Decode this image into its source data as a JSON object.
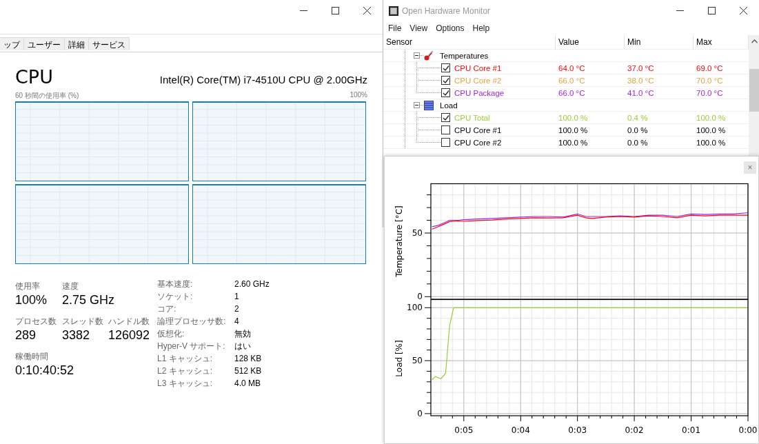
{
  "task_manager": {
    "tabs": [
      {
        "label": "ップ",
        "selected": false
      },
      {
        "label": "ユーザー",
        "selected": false
      },
      {
        "label": "詳細",
        "selected": false
      },
      {
        "label": "サービス",
        "selected": false
      }
    ],
    "heading": "CPU",
    "cpu_name": "Intel(R) Core(TM) i7-4510U CPU @ 2.00GHz",
    "graph_caption": "60 秒間の使用率 (%)",
    "graph_max": "100%",
    "cpu_graphs": [
      {
        "kind": "graph"
      },
      {
        "kind": "graph"
      },
      {
        "kind": "graph"
      },
      {
        "kind": "graph"
      }
    ],
    "stat_rows": [
      [
        {
          "label": "使用率",
          "value": "100%"
        },
        {
          "label": "速度",
          "value": "2.75 GHz"
        }
      ],
      [
        {
          "label": "プロセス数",
          "value": "289"
        },
        {
          "label": "スレッド数",
          "value": "3382"
        },
        {
          "label": "ハンドル数",
          "value": "126092"
        }
      ],
      [
        {
          "label": "稼働時間",
          "value": "0:10:40:52"
        }
      ]
    ],
    "details": [
      {
        "label": "基本速度:",
        "value": "2.60 GHz"
      },
      {
        "label": "ソケット:",
        "value": "1"
      },
      {
        "label": "コア:",
        "value": "2"
      },
      {
        "label": "論理プロセッサ数:",
        "value": "4"
      },
      {
        "label": "仮想化:",
        "value": "無効"
      },
      {
        "label": "Hyper-V サポート:",
        "value": "はい"
      },
      {
        "label": "L1 キャッシュ:",
        "value": "128 KB"
      },
      {
        "label": "L2 キャッシュ:",
        "value": "512 KB"
      },
      {
        "label": "L3 キャッシュ:",
        "value": "4.0 MB"
      }
    ]
  },
  "hardware_monitor": {
    "title": "Open Hardware Monitor",
    "menu": [
      "File",
      "View",
      "Options",
      "Help"
    ],
    "columns": [
      "Sensor",
      "Value",
      "Min",
      "Max"
    ],
    "groups": [
      {
        "label": "Temperatures",
        "kind": "temperature",
        "expanded": true,
        "children": [
          {
            "label": "CPU Core #1",
            "value": "64.0 °C",
            "min": "37.0 °C",
            "max": "69.0 °C",
            "checked": true,
            "color": "#ff0000"
          },
          {
            "label": "CPU Core #2",
            "value": "66.0 °C",
            "min": "38.0 °C",
            "max": "70.0 °C",
            "checked": true,
            "color": "#e6a23c"
          },
          {
            "label": "CPU Package",
            "value": "66.0 °C",
            "min": "41.0 °C",
            "max": "70.0 °C",
            "checked": true,
            "color": "#a020f0"
          }
        ]
      },
      {
        "label": "Load",
        "kind": "load",
        "expanded": true,
        "children": [
          {
            "label": "CPU Total",
            "value": "100.0 %",
            "min": "0.4 %",
            "max": "100.0 %",
            "checked": true,
            "color": "#9acd32"
          },
          {
            "label": "CPU Core #1",
            "value": "100.0 %",
            "min": "0.0 %",
            "max": "100.0 %",
            "checked": false,
            "color": "#000000"
          },
          {
            "label": "CPU Core #2",
            "value": "100.0 %",
            "min": "0.0 %",
            "max": "100.0 %",
            "checked": false,
            "color": "#000000"
          }
        ]
      }
    ]
  },
  "plot_window": {
    "close_label": "×",
    "charts": [
      {
        "chart_data": {
          "type": "line",
          "ylabel": "Temperature [°C]",
          "x": [
            -5.56,
            -5.45,
            -5.35,
            -5.25,
            -5.1,
            -5.0,
            -4.75,
            -4.5,
            -4.25,
            -4.0,
            -3.75,
            -3.5,
            -3.25,
            -3.0,
            -2.85,
            -2.75,
            -2.5,
            -2.25,
            -2.0,
            -1.75,
            -1.5,
            -1.25,
            -1.0,
            -0.75,
            -0.5,
            -0.25,
            0
          ],
          "series": [
            {
              "color": "#a020f0",
              "values": [
                55,
                56,
                58,
                60,
                60,
                60.5,
                61,
                61.5,
                62,
                62.5,
                63,
                63,
                62.5,
                65,
                63,
                63,
                63,
                63.5,
                63,
                64,
                64,
                63,
                65,
                64.5,
                65,
                65,
                66
              ]
            },
            {
              "color": "#ff0000",
              "values": [
                53,
                55,
                57,
                59,
                59.5,
                59.2,
                59.8,
                60.2,
                61,
                61.5,
                62,
                61.8,
                62,
                64,
                62,
                61.5,
                62.5,
                63,
                62.5,
                63.5,
                63,
                62,
                64,
                63.5,
                64,
                64,
                64
              ]
            }
          ],
          "xlim": [
            -5.58,
            0
          ],
          "ylim": [
            -2,
            89
          ],
          "yticks": [
            0,
            50
          ],
          "grid": true
        }
      },
      {
        "chart_data": {
          "type": "line",
          "ylabel": "Load [%]",
          "x": [
            -5.56,
            -5.5,
            -5.4,
            -5.32,
            -5.25,
            -5.18,
            -5,
            -4,
            -3,
            -2,
            -1,
            0
          ],
          "series": [
            {
              "color": "#9acd32",
              "values": [
                32,
                35,
                33,
                38,
                83,
                100,
                100,
                100,
                100,
                100,
                100,
                100
              ]
            }
          ],
          "xlim": [
            -5.58,
            0
          ],
          "ylim": [
            -2,
            108
          ],
          "xticks": [
            {
              "value": -5,
              "label": "0:05"
            },
            {
              "value": -4,
              "label": "0:04"
            },
            {
              "value": -3,
              "label": "0:03"
            },
            {
              "value": -2,
              "label": "0:02"
            },
            {
              "value": -1,
              "label": "0:01"
            },
            {
              "value": 0,
              "label": "0:00"
            }
          ],
          "yticks": [
            0,
            50,
            100
          ],
          "grid": true
        }
      }
    ]
  }
}
